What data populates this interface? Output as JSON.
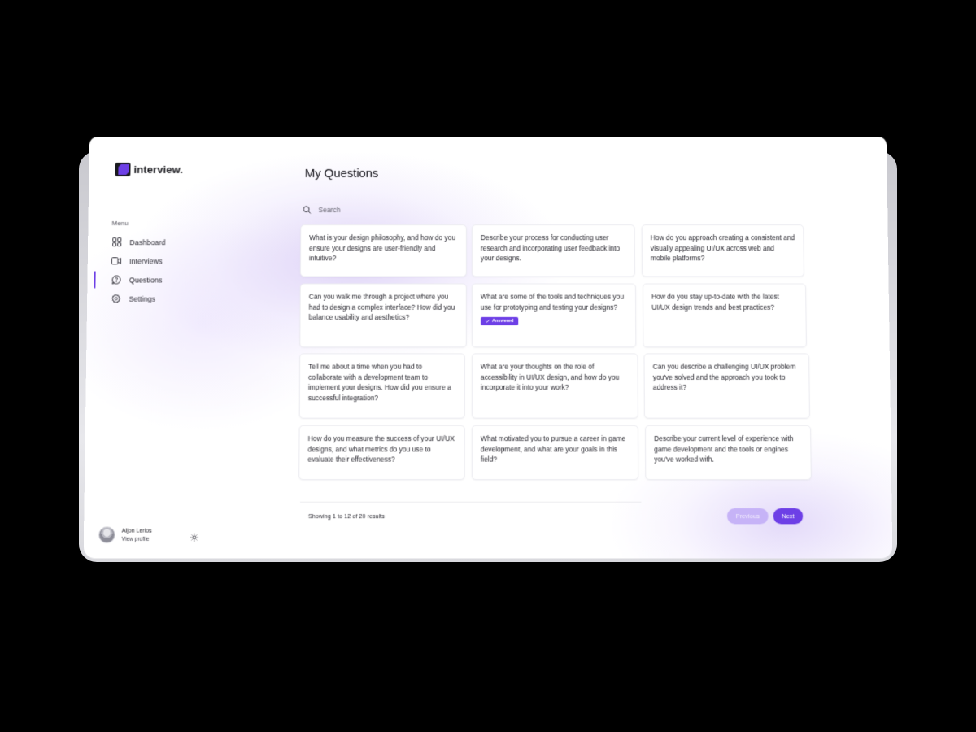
{
  "app": {
    "logo_text": "interview."
  },
  "sidebar": {
    "menu_label": "Menu",
    "items": [
      {
        "label": "Dashboard",
        "icon": "grid-icon"
      },
      {
        "label": "Interviews",
        "icon": "video-icon"
      },
      {
        "label": "Questions",
        "icon": "chat-question-icon",
        "active": true
      },
      {
        "label": "Settings",
        "icon": "gear-icon"
      }
    ],
    "profile": {
      "name": "Aljon Lerios",
      "link": "View profile"
    }
  },
  "main": {
    "title": "My Questions",
    "search": {
      "placeholder": "Search",
      "value": ""
    },
    "questions": [
      {
        "text": "What is your design philosophy, and how do you ensure your designs are user-friendly and intuitive?"
      },
      {
        "text": "Describe your process for conducting user research and incorporating user feedback into your designs."
      },
      {
        "text": "How do you approach creating a consistent and visually appealing UI/UX across web and mobile platforms?"
      },
      {
        "text": "Can you walk me through a project where you had to design a complex interface? How did you balance usability and aesthetics?"
      },
      {
        "text": "What are some of the tools and techniques you use for prototyping and testing your designs?",
        "badge": "Answered"
      },
      {
        "text": "How do you stay up-to-date with the latest UI/UX design trends and best practices?"
      },
      {
        "text": "Tell me about a time when you had to collaborate with a development team to implement your designs. How did you ensure a successful integration?"
      },
      {
        "text": "What are your thoughts on the role of accessibility in UI/UX design, and how do you incorporate it into your work?"
      },
      {
        "text": "Can you describe a challenging UI/UX problem you've solved and the approach you took to address it?"
      },
      {
        "text": "How do you measure the success of your UI/UX designs, and what metrics do you use to evaluate their effectiveness?"
      },
      {
        "text": "What motivated you to pursue a career in game development, and what are your goals in this field?"
      },
      {
        "text": "Describe your current level of experience with game development and the tools or engines you've worked with."
      }
    ],
    "pagination": {
      "results_text": "Showing 1 to 12 of 20 results",
      "previous_label": "Previous",
      "next_label": "Next"
    }
  },
  "colors": {
    "accent": "#6d3fe6",
    "accent_light": "#c6b3f7"
  }
}
